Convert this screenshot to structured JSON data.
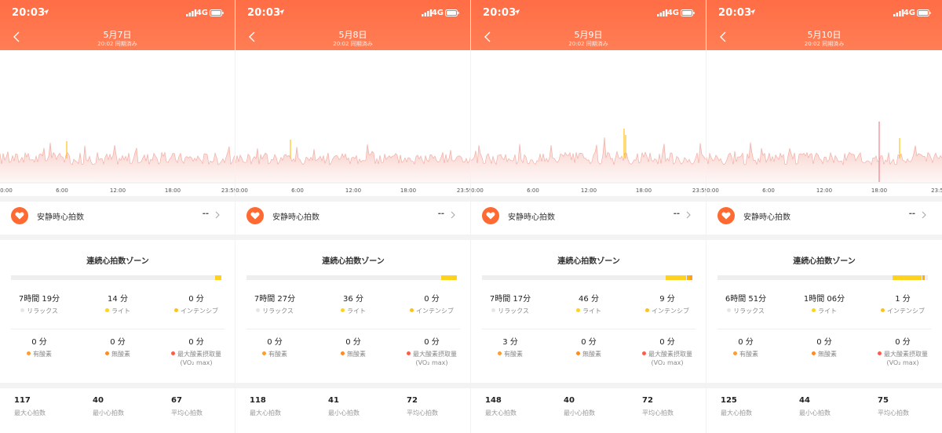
{
  "status_bar": {
    "time": "20:03",
    "network": "4G"
  },
  "colors": {
    "header": "#ff6d45",
    "accent": "#ff6a32",
    "relax": "#e6e6e6",
    "light": "#ffd21f",
    "intensive": "#ffc21a",
    "aerobic": "#ff9c2e",
    "anaerobic": "#ff8a1e",
    "vo2": "#ff5a4a"
  },
  "icons": {
    "back": "back-arrow-icon",
    "location": "location-arrow-icon",
    "signal": "signal-icon",
    "battery": "battery-icon",
    "heart": "heart-icon",
    "chevron": "chevron-right-icon"
  },
  "chart": {
    "x_ticks": [
      "0:00",
      "6:00",
      "12:00",
      "18:00",
      "23:59"
    ],
    "last_tick_screen4": "23:5"
  },
  "labels": {
    "synced": "20:02 同期済み",
    "resting_hr": "安静時心拍数",
    "resting_hr_value": "--",
    "zones_title": "連続心拍数ゾーン",
    "relax": "リラックス",
    "light": "ライト",
    "intensive": "インテンシブ",
    "aerobic": "有酸素",
    "anaerobic": "無酸素",
    "vo2": "最大酸素摂取量",
    "vo2_sub": "(VO₂ max)",
    "max_hr": "最大心拍数",
    "min_hr": "最小心拍数",
    "avg_hr": "平均心拍数"
  },
  "screens": [
    {
      "date": "5月7日",
      "relax": "7時間 19分",
      "light": "14 分",
      "intensive": "0 分",
      "aerobic": "0 分",
      "anaerobic": "0 分",
      "vo2": "0 分",
      "max": "117",
      "min": "40",
      "avg": "67",
      "zone_minutes": {
        "relax": 439,
        "light": 14,
        "intensive": 0
      }
    },
    {
      "date": "5月8日",
      "relax": "7時間 27分",
      "light": "36 分",
      "intensive": "0 分",
      "aerobic": "0 分",
      "anaerobic": "0 分",
      "vo2": "0 分",
      "max": "118",
      "min": "41",
      "avg": "72",
      "zone_minutes": {
        "relax": 447,
        "light": 36,
        "intensive": 0
      }
    },
    {
      "date": "5月9日",
      "relax": "7時間 17分",
      "light": "46 分",
      "intensive": "9 分",
      "aerobic": "3 分",
      "anaerobic": "0 分",
      "vo2": "0 分",
      "max": "148",
      "min": "40",
      "avg": "72",
      "zone_minutes": {
        "relax": 437,
        "light": 46,
        "intensive": 9
      }
    },
    {
      "date": "5月10日",
      "relax": "6時間 51分",
      "light": "1時間 06分",
      "intensive": "1 分",
      "aerobic": "0 分",
      "anaerobic": "0 分",
      "vo2": "0 分",
      "max": "125",
      "min": "44",
      "avg": "75",
      "zone_minutes": {
        "relax": 411,
        "light": 66,
        "intensive": 1
      }
    }
  ]
}
